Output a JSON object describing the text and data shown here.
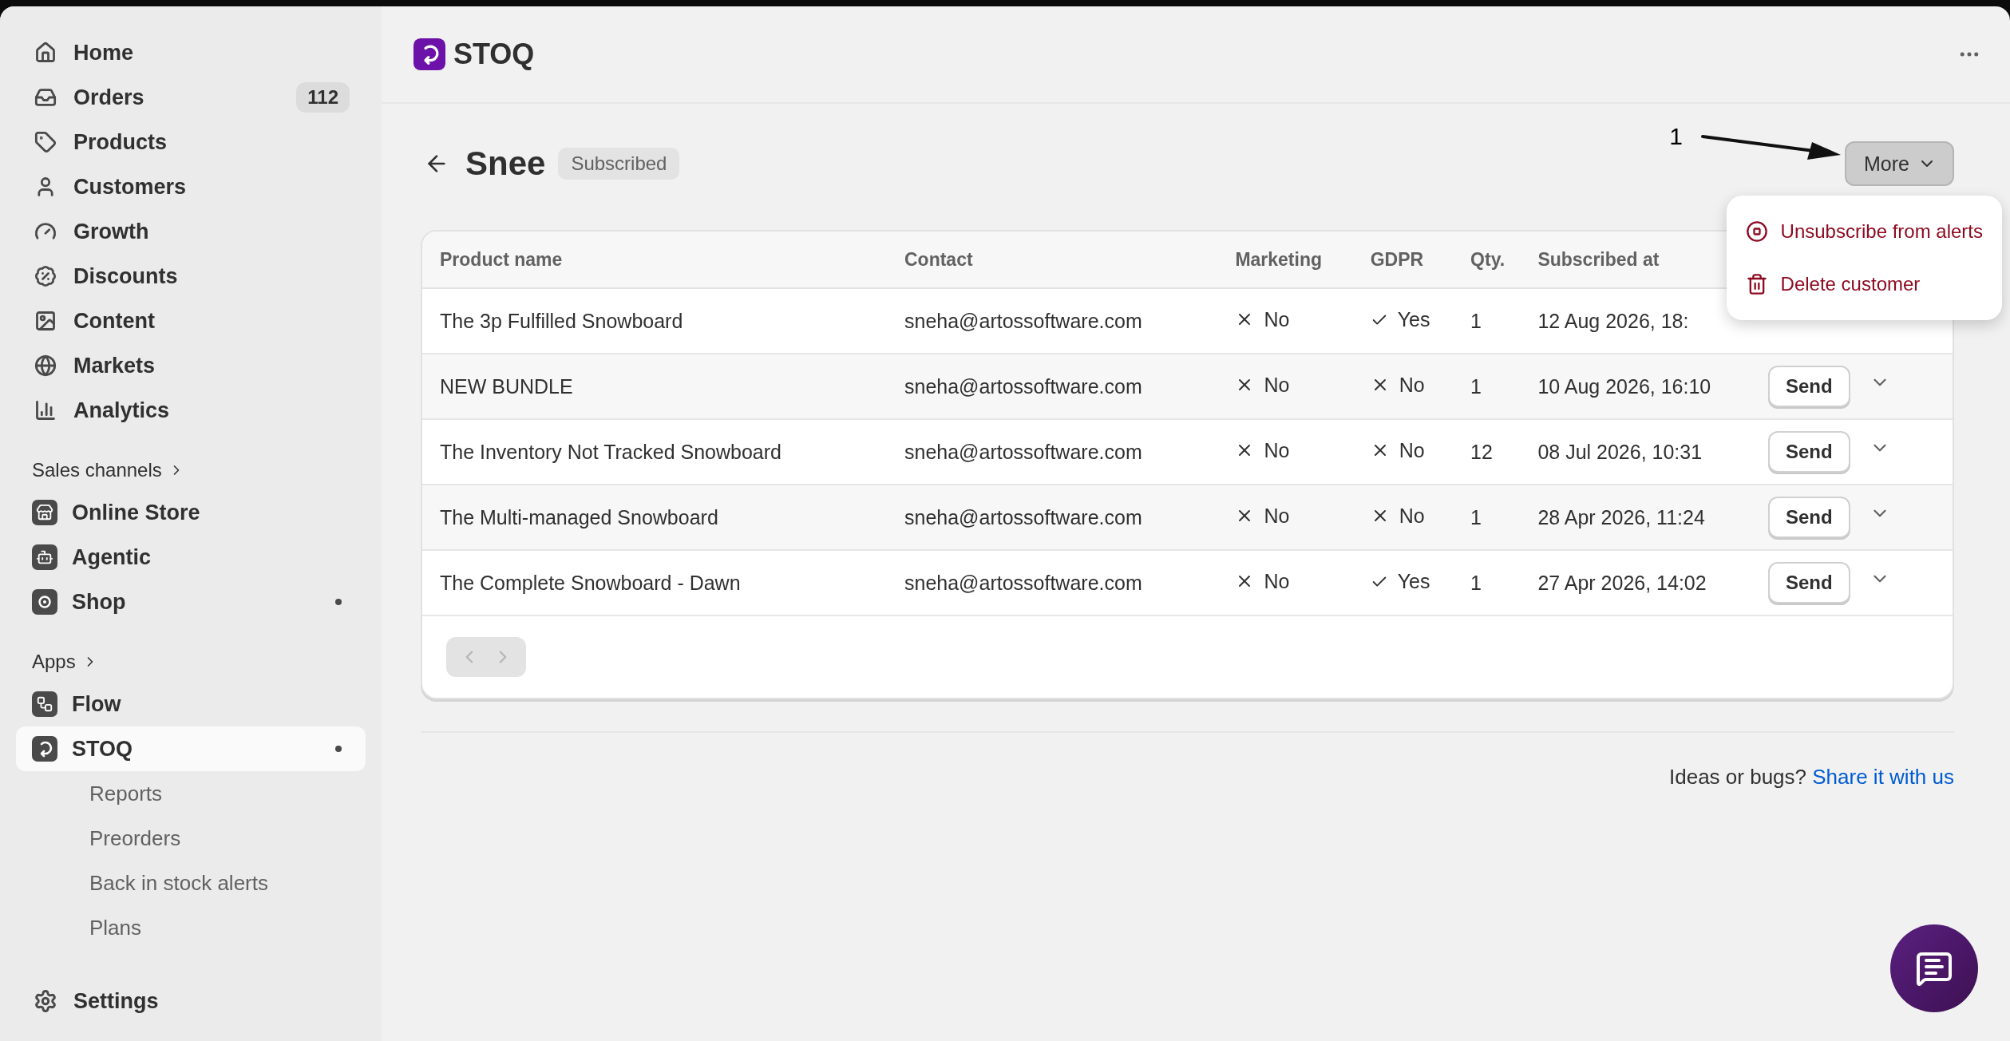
{
  "app": {
    "name": "STOQ"
  },
  "sidebar": {
    "sections": [
      {
        "items": [
          {
            "label": "Home",
            "selected": false,
            "dot": false
          },
          {
            "label": "Orders",
            "badge": "112",
            "selected": false,
            "dot": false
          },
          {
            "label": "Products",
            "selected": false,
            "dot": false
          },
          {
            "label": "Customers",
            "selected": false,
            "dot": false
          },
          {
            "label": "Growth",
            "selected": false,
            "dot": false
          },
          {
            "label": "Discounts",
            "selected": false,
            "dot": false
          },
          {
            "label": "Content",
            "selected": false,
            "dot": false
          },
          {
            "label": "Markets",
            "selected": false,
            "dot": false
          },
          {
            "label": "Analytics",
            "selected": false,
            "dot": false
          }
        ]
      },
      {
        "heading": "Sales channels",
        "items": [
          {
            "label": "Online Store",
            "selected": false,
            "dot": false
          },
          {
            "label": "Agentic",
            "selected": false,
            "dot": false
          },
          {
            "label": "Shop",
            "selected": false,
            "dot": true
          }
        ]
      },
      {
        "heading": "Apps",
        "items": [
          {
            "label": "Flow",
            "selected": false,
            "dot": false
          },
          {
            "label": "STOQ",
            "selected": true,
            "dot": true,
            "children": [
              {
                "label": "Reports"
              },
              {
                "label": "Preorders"
              },
              {
                "label": "Back in stock alerts"
              },
              {
                "label": "Plans"
              }
            ]
          }
        ]
      },
      {
        "items": [
          {
            "label": "Settings",
            "selected": false,
            "dot": false
          }
        ]
      }
    ]
  },
  "page": {
    "title": "Snee",
    "status": "Subscribed",
    "more_button": "More",
    "annotation": "1"
  },
  "menu": {
    "items": [
      {
        "label": "Unsubscribe from alerts",
        "kind": "unsubscribe"
      },
      {
        "label": "Delete customer",
        "kind": "delete"
      }
    ]
  },
  "table": {
    "columns": [
      "Product name",
      "Contact",
      "Marketing",
      "GDPR",
      "Qty.",
      "Subscribed at"
    ],
    "rows": [
      {
        "product": "The 3p Fulfilled Snowboard",
        "contact": "sneha@artossoftware.com",
        "marketing": {
          "label": "No",
          "on": false
        },
        "gdpr": {
          "label": "Yes",
          "on": true
        },
        "qty": "1",
        "subscribed": "12 Aug 2026, 18:"
      },
      {
        "product": "NEW BUNDLE",
        "contact": "sneha@artossoftware.com",
        "marketing": {
          "label": "No",
          "on": false
        },
        "gdpr": {
          "label": "No",
          "on": false
        },
        "qty": "1",
        "subscribed": "10 Aug 2026, 16:10",
        "action": "Send"
      },
      {
        "product": "The Inventory Not Tracked Snowboard",
        "contact": "sneha@artossoftware.com",
        "marketing": {
          "label": "No",
          "on": false
        },
        "gdpr": {
          "label": "No",
          "on": false
        },
        "qty": "12",
        "subscribed": "08 Jul 2026, 10:31",
        "action": "Send"
      },
      {
        "product": "The Multi-managed Snowboard",
        "contact": "sneha@artossoftware.com",
        "marketing": {
          "label": "No",
          "on": false
        },
        "gdpr": {
          "label": "No",
          "on": false
        },
        "qty": "1",
        "subscribed": "28 Apr 2026, 11:24",
        "action": "Send"
      },
      {
        "product": "The Complete Snowboard - Dawn",
        "contact": "sneha@artossoftware.com",
        "marketing": {
          "label": "No",
          "on": false
        },
        "gdpr": {
          "label": "Yes",
          "on": true
        },
        "qty": "1",
        "subscribed": "27 Apr 2026, 14:02",
        "action": "Send"
      }
    ]
  },
  "footer": {
    "text": "Ideas or bugs?",
    "link": "Share it with us"
  }
}
